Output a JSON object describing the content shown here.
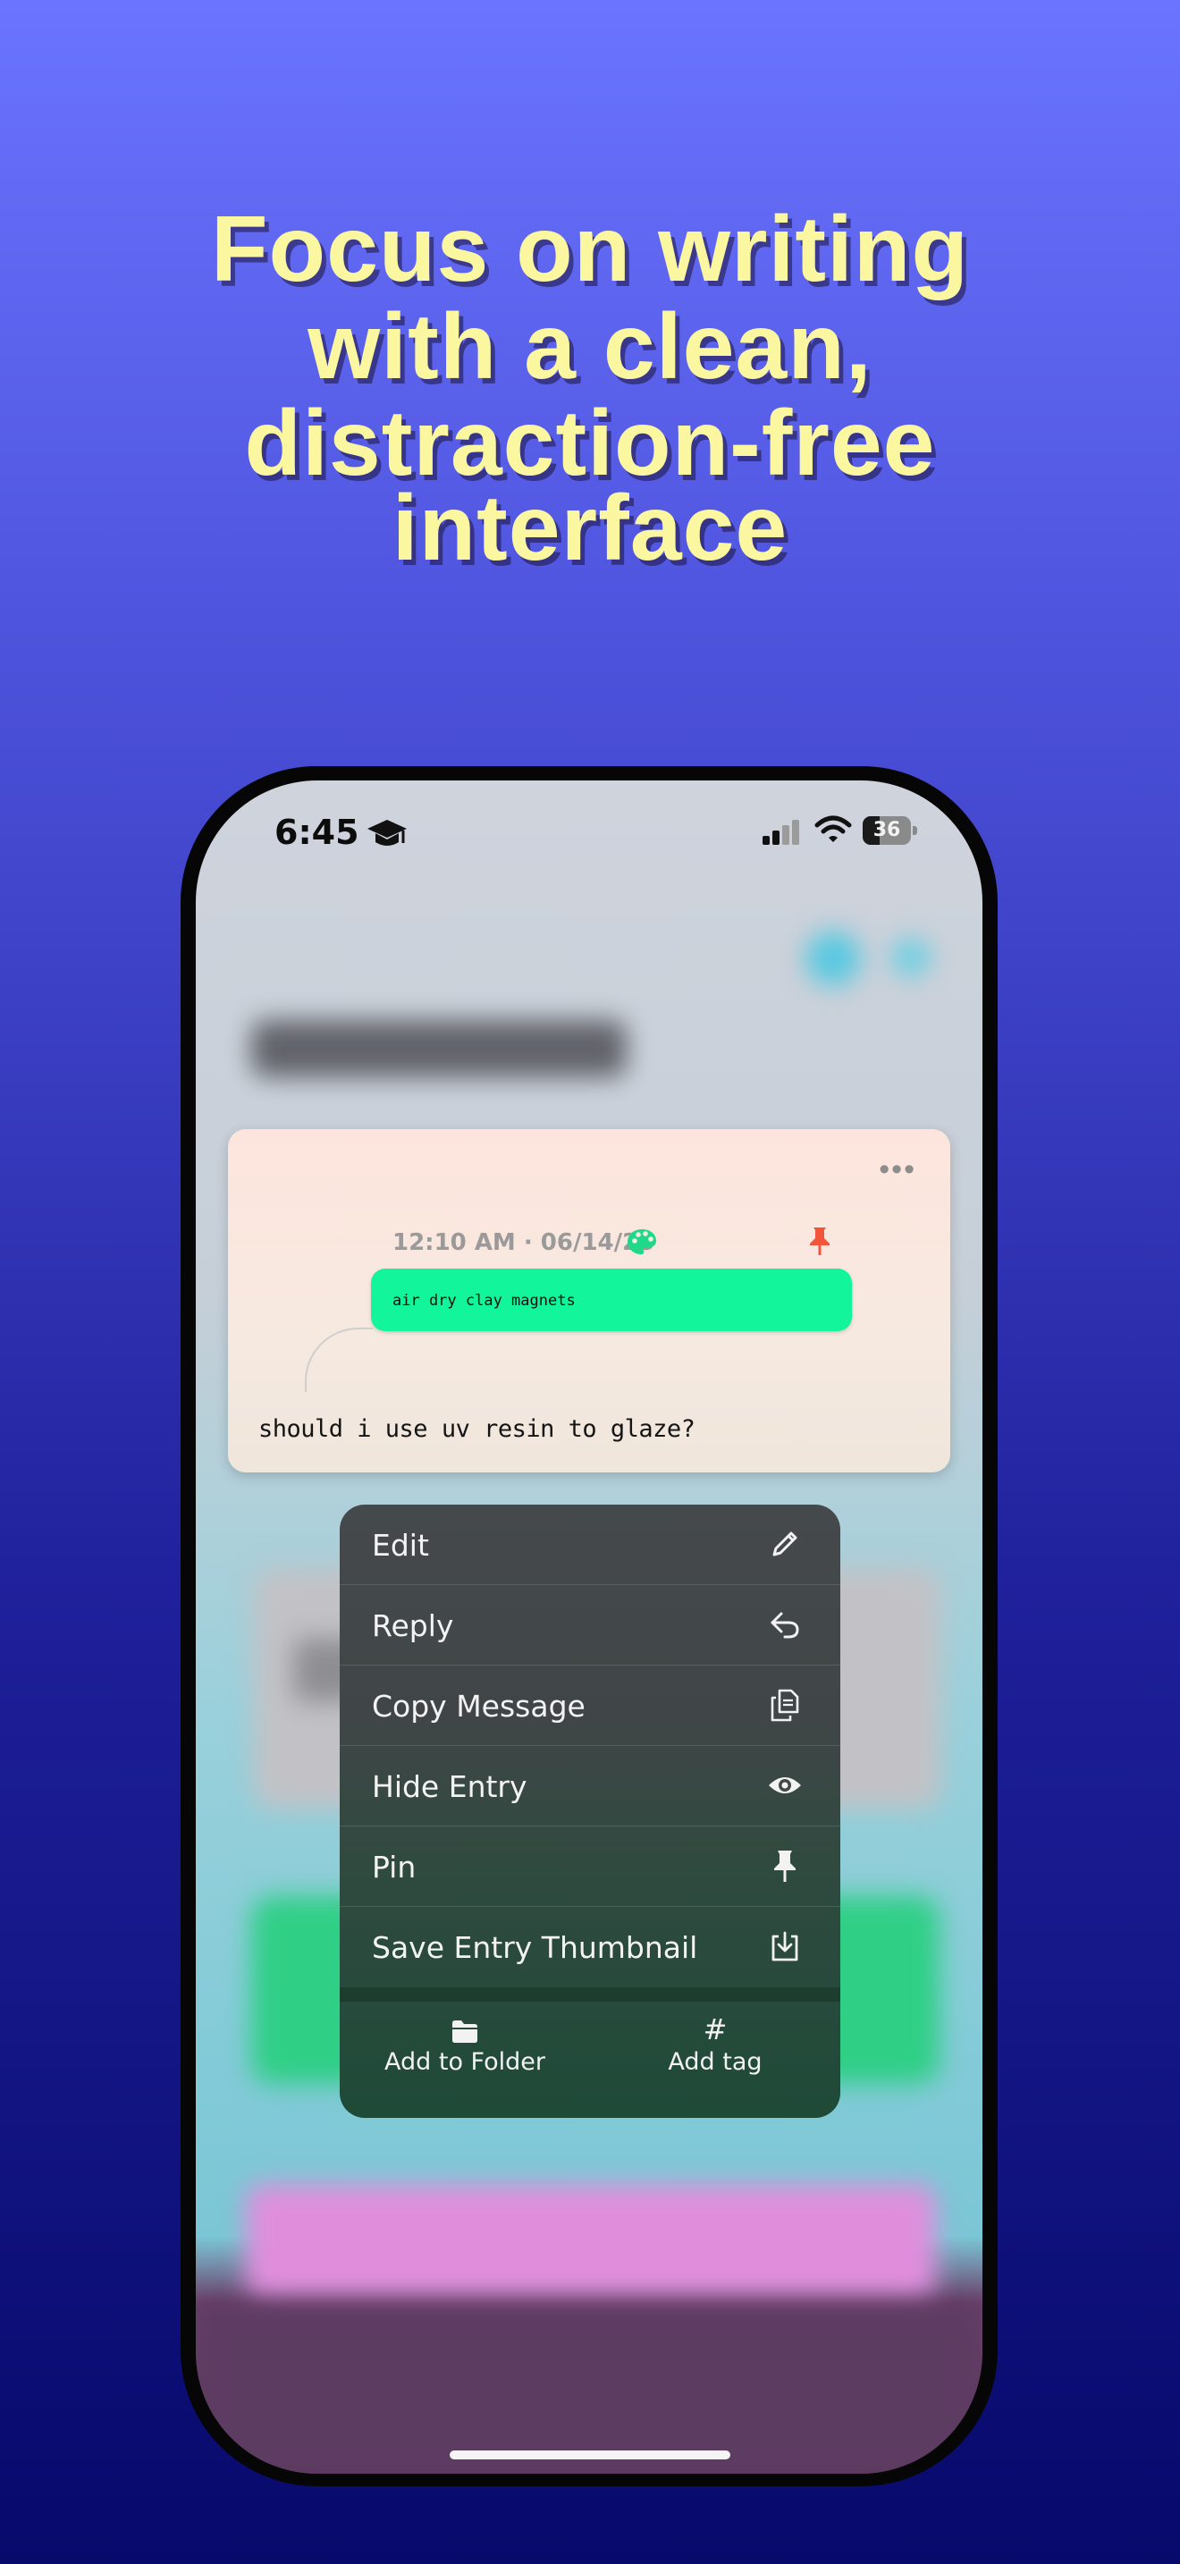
{
  "headline": {
    "lines": [
      "Focus on writing",
      "with a clean,",
      "distraction-free",
      "interface"
    ]
  },
  "status_bar": {
    "time": "6:45",
    "battery": "36",
    "battery_level": 0.36,
    "icons": [
      "graduation-cap-icon",
      "cellular-signal-icon",
      "wifi-icon",
      "battery-icon"
    ]
  },
  "entry_card": {
    "more_icon": "ellipsis-icon",
    "meta": "12:10 AM · 06/14/25",
    "palette_icon": "palette-icon",
    "pin_icon": "pin-icon",
    "quoted_message": "air dry clay magnets",
    "body": "should i use uv resin to glaze?",
    "colors": {
      "bubble": "#12f59a",
      "pin": "#f2553b",
      "palette": "#1fd989"
    }
  },
  "context_menu": {
    "items": [
      {
        "label": "Edit",
        "icon": "pencil-icon"
      },
      {
        "label": "Reply",
        "icon": "reply-arrow-icon"
      },
      {
        "label": "Copy Message",
        "icon": "copy-icon"
      },
      {
        "label": "Hide Entry",
        "icon": "eye-icon"
      },
      {
        "label": "Pin",
        "icon": "pin-icon"
      },
      {
        "label": "Save Entry Thumbnail",
        "icon": "download-tray-icon"
      }
    ],
    "bottom_actions": [
      {
        "label": "Add to Folder",
        "icon": "folder-icon"
      },
      {
        "label": "Add tag",
        "icon": "#"
      }
    ]
  },
  "colors": {
    "headline": "#fbf6a0",
    "background_top": "#6b74ff",
    "background_bottom": "#07096b"
  }
}
